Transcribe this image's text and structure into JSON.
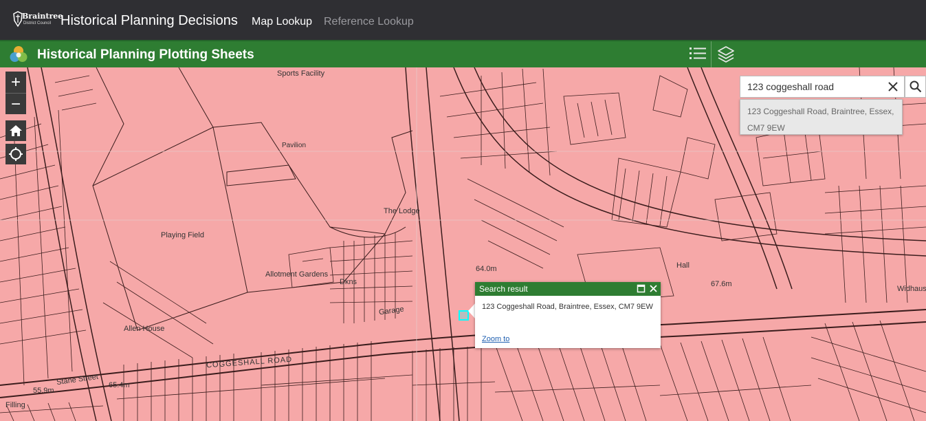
{
  "header": {
    "logo_line1": "Braintree",
    "logo_line2": "District Council",
    "title": "Historical Planning Decisions",
    "nav": [
      {
        "label": "Map Lookup",
        "active": true
      },
      {
        "label": "Reference Lookup",
        "active": false
      }
    ]
  },
  "subheader": {
    "title": "Historical Planning Plotting Sheets",
    "legend_icon": "legend-list-icon",
    "layers_icon": "layers-icon"
  },
  "map_controls": {
    "zoom_in": "+",
    "zoom_out": "−",
    "home_icon": "home-icon",
    "locate_icon": "locate-icon"
  },
  "search": {
    "value": "123 coggeshall road",
    "suggestion": "123 Coggeshall Road, Braintree, Essex, CM7 9EW"
  },
  "popup": {
    "title": "Search result",
    "address": "123 Coggeshall Road, Braintree, Essex, CM7 9EW",
    "zoom_link": "Zoom to"
  },
  "map_labels": [
    {
      "text": "Sports Facility"
    },
    {
      "text": "Pavilion"
    },
    {
      "text": "The Lodge"
    },
    {
      "text": "Playing Field"
    },
    {
      "text": "Allotment Gardens"
    },
    {
      "text": "Allen House"
    },
    {
      "text": "Garage"
    },
    {
      "text": "COGGESHALL ROAD"
    },
    {
      "text": "Stane Street"
    },
    {
      "text": "65.4m"
    },
    {
      "text": "64.0m"
    },
    {
      "text": "67.6m"
    },
    {
      "text": "55.9m"
    },
    {
      "text": "Filling"
    },
    {
      "text": "Hall"
    },
    {
      "text": "Widhaus"
    },
    {
      "text": "Dkns"
    }
  ],
  "colors": {
    "header_bg": "#2f2f33",
    "subheader_bg": "#2e7d32",
    "map_fill": "#f6a8a8",
    "parcel_line": "#3a1c1c",
    "marker": "#00ffff"
  }
}
